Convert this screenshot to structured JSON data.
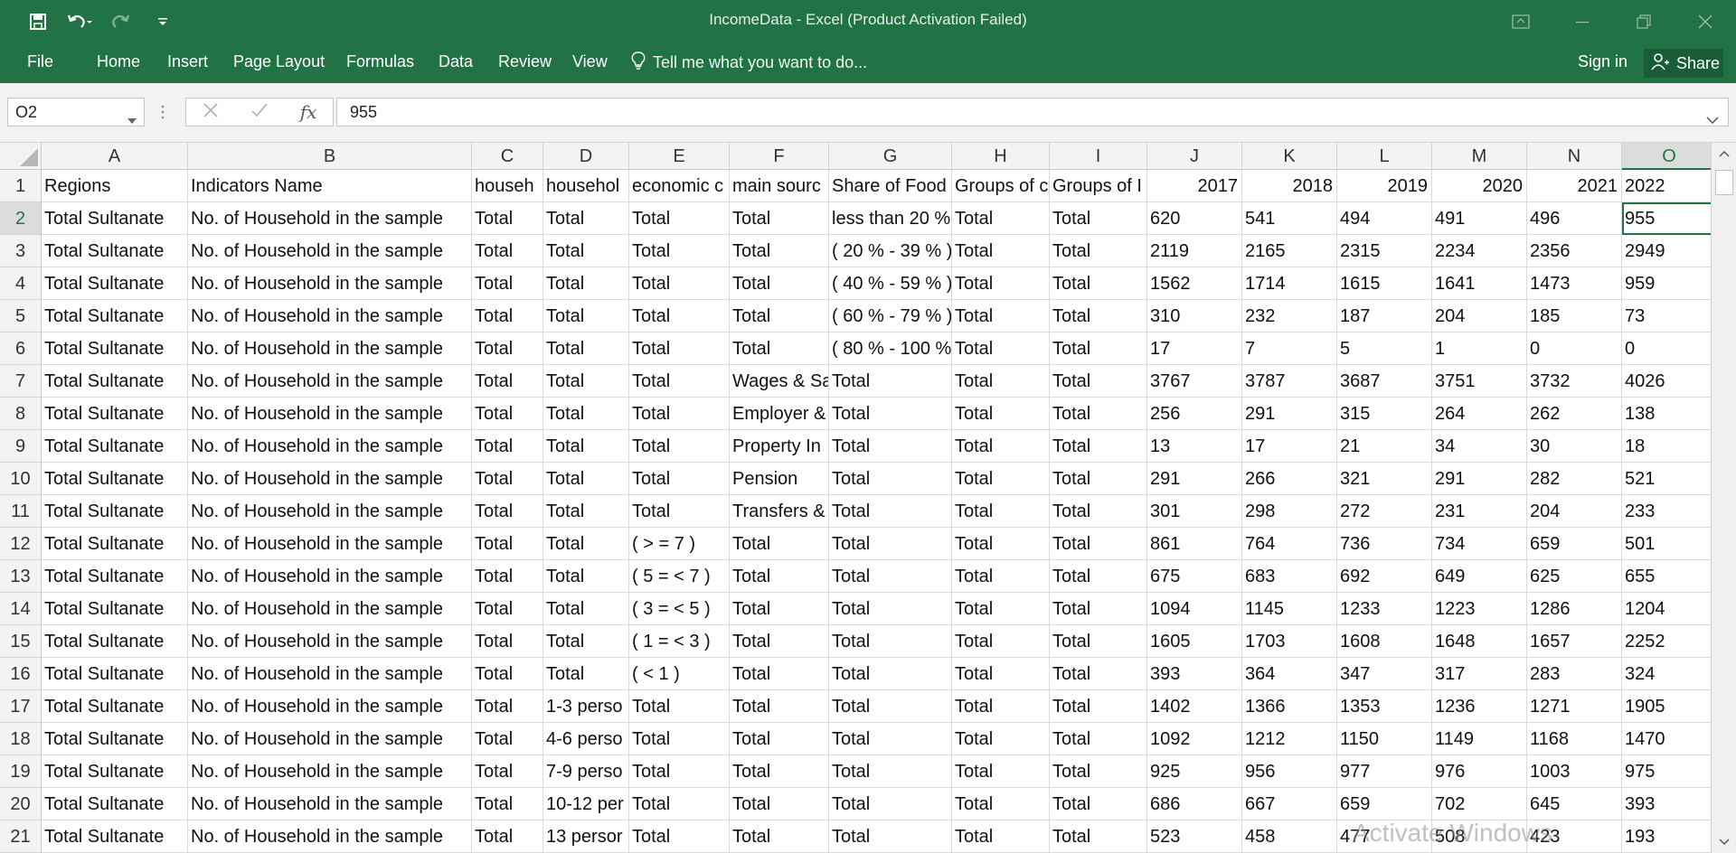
{
  "window": {
    "title": "IncomeData - Excel (Product Activation Failed)"
  },
  "colors": {
    "brand": "#217346",
    "grid_line": "#dadada",
    "header_bg": "#f3f3f3"
  },
  "ribbon": {
    "tabs": [
      "File",
      "Home",
      "Insert",
      "Page Layout",
      "Formulas",
      "Data",
      "Review",
      "View"
    ],
    "tell_me": "Tell me what you want to do...",
    "sign_in": "Sign in",
    "share": "Share"
  },
  "formula_bar": {
    "name_box": "O2",
    "fx_label": "fx",
    "value": "955"
  },
  "sheet": {
    "columns": [
      "A",
      "B",
      "C",
      "D",
      "E",
      "F",
      "G",
      "H",
      "I",
      "J",
      "K",
      "L",
      "M",
      "N",
      "O"
    ],
    "rows": [
      [
        "Regions",
        "Indicators Name",
        "househ",
        "househol",
        "economic c",
        "main sourc",
        "Share of Food",
        "Groups of c",
        "Groups of I",
        "2017",
        "2018",
        "2019",
        "2020",
        "2021",
        "2022"
      ],
      [
        "Total Sultanate",
        "No. of Household in the sample",
        "Total",
        "Total",
        "Total",
        "Total",
        "less than 20 %",
        "Total",
        "Total",
        "620",
        "541",
        "494",
        "491",
        "496",
        "955"
      ],
      [
        "Total Sultanate",
        "No. of Household in the sample",
        "Total",
        "Total",
        "Total",
        "Total",
        "( 20 % - 39 % )",
        "Total",
        "Total",
        "2119",
        "2165",
        "2315",
        "2234",
        "2356",
        "2949"
      ],
      [
        "Total Sultanate",
        "No. of Household in the sample",
        "Total",
        "Total",
        "Total",
        "Total",
        "( 40 % - 59 % )",
        "Total",
        "Total",
        "1562",
        "1714",
        "1615",
        "1641",
        "1473",
        "959"
      ],
      [
        "Total Sultanate",
        "No. of Household in the sample",
        "Total",
        "Total",
        "Total",
        "Total",
        "( 60 % - 79 % )",
        "Total",
        "Total",
        "310",
        "232",
        "187",
        "204",
        "185",
        "73"
      ],
      [
        "Total Sultanate",
        "No. of Household in the sample",
        "Total",
        "Total",
        "Total",
        "Total",
        "( 80 % - 100 %",
        "Total",
        "Total",
        "17",
        "7",
        "5",
        "1",
        "0",
        "0"
      ],
      [
        "Total Sultanate",
        "No. of Household in the sample",
        "Total",
        "Total",
        "Total",
        "Wages & Sa",
        "Total",
        "Total",
        "Total",
        "3767",
        "3787",
        "3687",
        "3751",
        "3732",
        "4026"
      ],
      [
        "Total Sultanate",
        "No. of Household in the sample",
        "Total",
        "Total",
        "Total",
        "Employer &",
        "Total",
        "Total",
        "Total",
        "256",
        "291",
        "315",
        "264",
        "262",
        "138"
      ],
      [
        "Total Sultanate",
        "No. of Household in the sample",
        "Total",
        "Total",
        "Total",
        "Property In",
        "Total",
        "Total",
        "Total",
        "13",
        "17",
        "21",
        "34",
        "30",
        "18"
      ],
      [
        "Total Sultanate",
        "No. of Household in the sample",
        "Total",
        "Total",
        "Total",
        "Pension",
        "Total",
        "Total",
        "Total",
        "291",
        "266",
        "321",
        "291",
        "282",
        "521"
      ],
      [
        "Total Sultanate",
        "No. of Household in the sample",
        "Total",
        "Total",
        "Total",
        "Transfers &",
        "Total",
        "Total",
        "Total",
        "301",
        "298",
        "272",
        "231",
        "204",
        "233"
      ],
      [
        "Total Sultanate",
        "No. of Household in the sample",
        "Total",
        "Total",
        "( > = 7 )",
        "Total",
        "Total",
        "Total",
        "Total",
        "861",
        "764",
        "736",
        "734",
        "659",
        "501"
      ],
      [
        "Total Sultanate",
        "No. of Household in the sample",
        "Total",
        "Total",
        "( 5 = < 7 )",
        "Total",
        "Total",
        "Total",
        "Total",
        "675",
        "683",
        "692",
        "649",
        "625",
        "655"
      ],
      [
        "Total Sultanate",
        "No. of Household in the sample",
        "Total",
        "Total",
        "( 3 = < 5 )",
        "Total",
        "Total",
        "Total",
        "Total",
        "1094",
        "1145",
        "1233",
        "1223",
        "1286",
        "1204"
      ],
      [
        "Total Sultanate",
        "No. of Household in the sample",
        "Total",
        "Total",
        "( 1 = < 3 )",
        "Total",
        "Total",
        "Total",
        "Total",
        "1605",
        "1703",
        "1608",
        "1648",
        "1657",
        "2252"
      ],
      [
        "Total Sultanate",
        "No. of Household in the sample",
        "Total",
        "Total",
        "( < 1 )",
        "Total",
        "Total",
        "Total",
        "Total",
        "393",
        "364",
        "347",
        "317",
        "283",
        "324"
      ],
      [
        "Total Sultanate",
        "No. of Household in the sample",
        "Total",
        "1-3 perso",
        "Total",
        "Total",
        "Total",
        "Total",
        "Total",
        "1402",
        "1366",
        "1353",
        "1236",
        "1271",
        "1905"
      ],
      [
        "Total Sultanate",
        "No. of Household in the sample",
        "Total",
        "4-6 perso",
        "Total",
        "Total",
        "Total",
        "Total",
        "Total",
        "1092",
        "1212",
        "1150",
        "1149",
        "1168",
        "1470"
      ],
      [
        "Total Sultanate",
        "No. of Household in the sample",
        "Total",
        "7-9 perso",
        "Total",
        "Total",
        "Total",
        "Total",
        "Total",
        "925",
        "956",
        "977",
        "976",
        "1003",
        "975"
      ],
      [
        "Total Sultanate",
        "No. of Household in the sample",
        "Total",
        "10-12 per",
        "Total",
        "Total",
        "Total",
        "Total",
        "Total",
        "686",
        "667",
        "659",
        "702",
        "645",
        "393"
      ],
      [
        "Total Sultanate",
        "No. of Household in the sample",
        "Total",
        "13 persor",
        "Total",
        "Total",
        "Total",
        "Total",
        "Total",
        "523",
        "458",
        "477",
        "508",
        "423",
        "193"
      ]
    ],
    "active_cell": {
      "row": 2,
      "col": "O"
    }
  },
  "watermark": "Activate Windows"
}
